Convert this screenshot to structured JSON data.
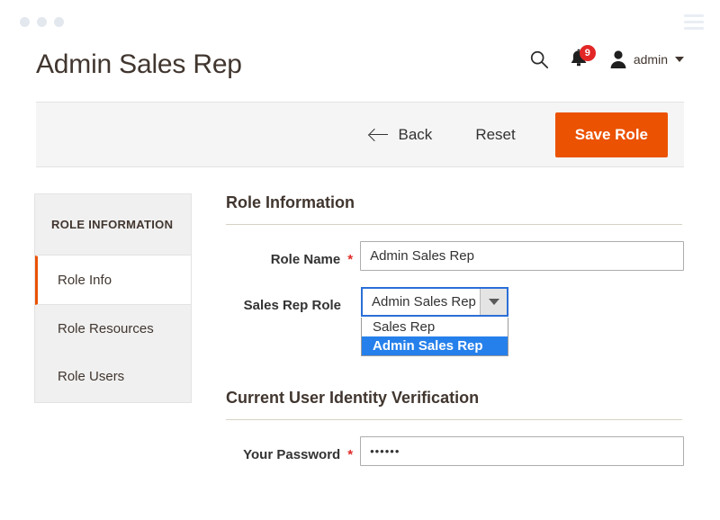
{
  "window": {
    "dots": [
      "dot-1",
      "dot-2",
      "dot-3"
    ],
    "menu_icon": "hamburger-menu-icon"
  },
  "header": {
    "title": "Admin Sales Rep",
    "search_icon": "search-icon",
    "notifications": {
      "icon": "bell-icon",
      "count": "9",
      "badge_color": "#e22626"
    },
    "user": {
      "avatar_icon": "user-avatar-icon",
      "name": "admin",
      "caret_icon": "chevron-down-icon"
    }
  },
  "toolbar": {
    "back_label": "Back",
    "back_icon": "arrow-left-icon",
    "reset_label": "Reset",
    "save_label": "Save Role",
    "save_color": "#eb5202"
  },
  "sidebar": {
    "title": "ROLE INFORMATION",
    "items": [
      {
        "label": "Role Info",
        "active": true
      },
      {
        "label": "Role Resources",
        "active": false
      },
      {
        "label": "Role Users",
        "active": false
      }
    ],
    "active_accent": "#eb5202"
  },
  "main": {
    "sections": [
      {
        "title": "Role Information",
        "fields": [
          {
            "label": "Role Name",
            "required": "*",
            "type": "text",
            "value": "Admin Sales Rep",
            "placeholder": ""
          },
          {
            "label": "Sales Rep Role",
            "required": "",
            "type": "select",
            "value": "Admin Sales Rep",
            "expanded": true,
            "options": [
              {
                "label": "Sales Rep",
                "selected": false
              },
              {
                "label": "Admin Sales Rep",
                "selected": true
              }
            ],
            "highlight_color": "#2680eb"
          }
        ]
      },
      {
        "title": "Current User Identity Verification",
        "fields": [
          {
            "label": "Your Password",
            "required": "*",
            "type": "password",
            "value": "••••••",
            "placeholder": ""
          }
        ]
      }
    ]
  }
}
